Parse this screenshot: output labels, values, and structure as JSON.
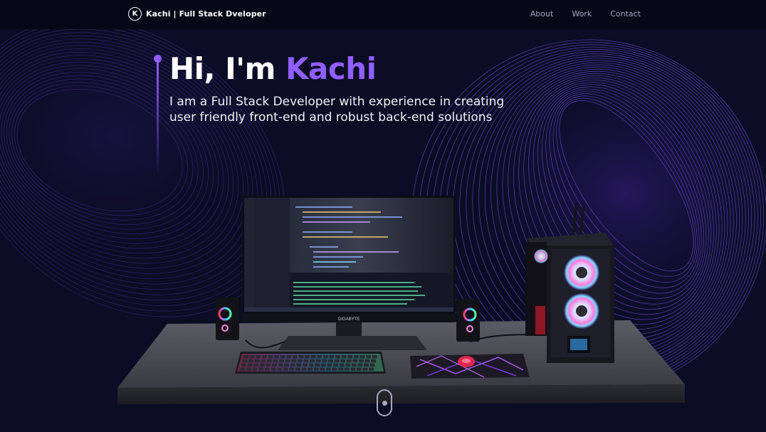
{
  "nav": {
    "brand_first": "Kachi",
    "brand_rest": "| Full Stack Dveloper",
    "links": [
      "About",
      "Work",
      "Contact"
    ]
  },
  "hero": {
    "greeting": "Hi, I'm",
    "name": "Kachi",
    "subtitle_line1": "I am a Full Stack Developer with experience in creating",
    "subtitle_line2": "user friendly front-end and robust back-end solutions"
  },
  "scene": {
    "monitor_brand": "GIGABYTE"
  },
  "colors": {
    "accent": "#915eff",
    "background": "#070a1c",
    "nav_text": "#aaa6c3"
  },
  "icons": {
    "logo": "kachi-logo-icon",
    "scroll": "mouse-scroll-icon"
  }
}
